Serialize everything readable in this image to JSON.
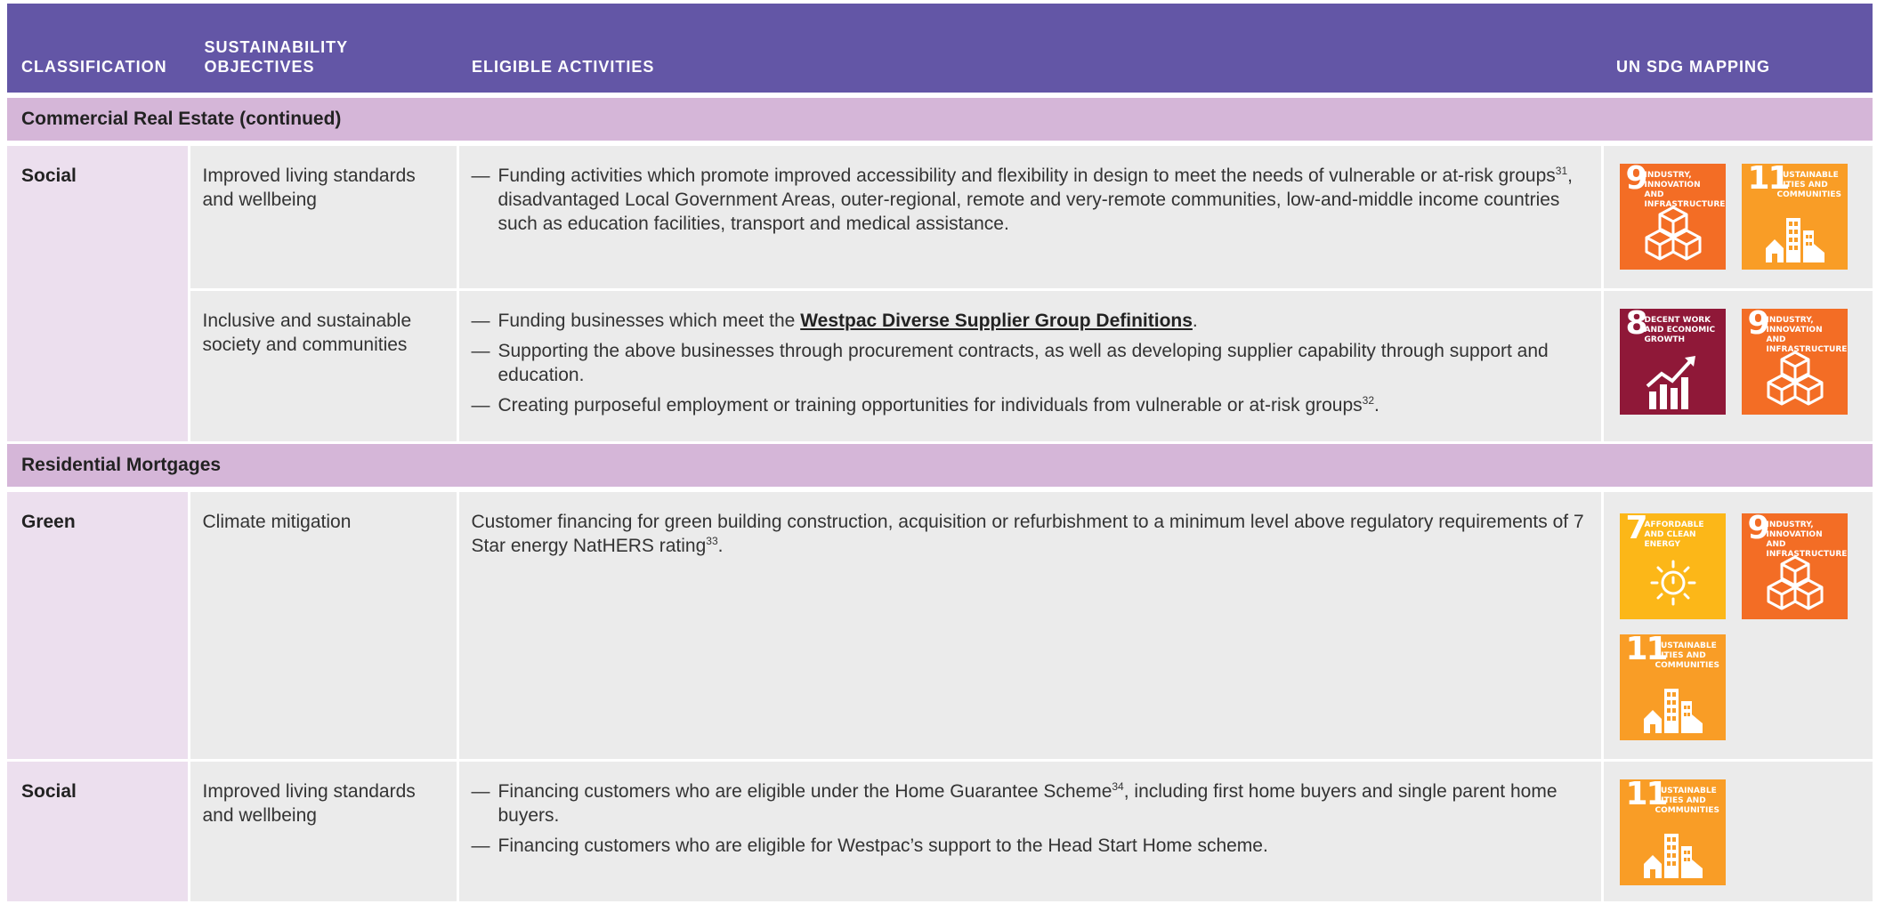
{
  "header": {
    "col_classification": "CLASSIFICATION",
    "col_objectives_line1": "SUSTAINABILITY",
    "col_objectives_line2": "OBJECTIVES",
    "col_activities": "ELIGIBLE ACTIVITIES",
    "col_sdg": "UN SDG MAPPING"
  },
  "sections": {
    "cre": "Commercial Real Estate (continued)",
    "rm": "Residential Mortgages"
  },
  "rows": {
    "cre_social": {
      "classification": "Social",
      "objective1": "Improved living standards and wellbeing",
      "activity1": "Funding activities which promote improved accessibility and flexibility in design to meet the needs of vulnerable or at-risk groups",
      "activity1_sup": "31",
      "activity1_rest": ", disadvantaged Local Government Areas, outer-regional, remote and very-remote communities, low-and-middle income countries such as education facilities, transport and medical assistance.",
      "objective2": "Inclusive and sustainable society and communities",
      "activity2a_pre": "Funding businesses which meet the ",
      "activity2a_link": "Westpac Diverse Supplier Group Definitions",
      "activity2a_post": ".",
      "activity2b": "Supporting the above businesses through procurement contracts, as well as developing supplier capability through support and education.",
      "activity2c": "Creating purposeful employment or training opportunities for individuals from vulnerable or at-risk groups",
      "activity2c_sup": "32",
      "activity2c_post": "."
    },
    "rm_green": {
      "classification": "Green",
      "objective": "Climate mitigation",
      "activity": "Customer financing for green building construction, acquisition or refurbishment to a minimum level above regulatory requirements of 7 Star energy NatHERS rating",
      "activity_sup": "33",
      "activity_post": "."
    },
    "rm_social": {
      "classification": "Social",
      "objective": "Improved living standards and wellbeing",
      "activity1": "Financing customers who are eligible under the Home Guarantee Scheme",
      "activity1_sup": "34",
      "activity1_rest": ", including first home buyers and single parent home buyers.",
      "activity2": "Financing customers who are eligible for Westpac’s support to the Head Start Home scheme."
    }
  },
  "sdg": {
    "g7": {
      "num": "7",
      "label": "Affordable and clean energy",
      "color": "#fcb718",
      "icon": "sun-power-icon"
    },
    "g8": {
      "num": "8",
      "label": "Decent work and economic growth",
      "color": "#8f1838",
      "icon": "growth-chart-icon"
    },
    "g9": {
      "num": "9",
      "label": "Industry, innovation and infrastructure",
      "color": "#f36d25",
      "icon": "cubes-icon"
    },
    "g11": {
      "num": "11",
      "label": "Sustainable cities and communities",
      "color": "#f99d26",
      "icon": "city-buildings-icon"
    }
  },
  "colors": {
    "header": "#6356a6",
    "section": "#d5b6d8",
    "classification_cell": "#ecdfee",
    "cell": "#ebebeb"
  }
}
